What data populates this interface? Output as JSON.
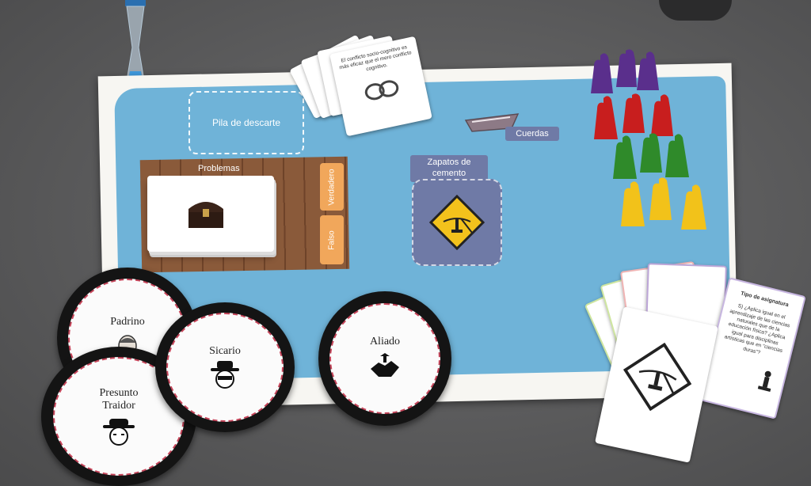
{
  "board": {
    "discard_label": "Pila de descarte",
    "problems_label": "Problemas",
    "true_label": "Verdadero",
    "false_label": "Falso",
    "cement_label": "Zapatos de cemento",
    "ropes_label": "Cuerdas"
  },
  "cards": {
    "top_card_text": "El conflicto socio-cognitivo es más eficaz que el mero conflicto cognitivo.",
    "right_card_title": "Tipo de asignatura",
    "right_card_text": "S) ¿Aplica igual en el aprendizaje de las ciencias naturales que de la educación física? ¿Aplica igual para disciplinas artísticas que en \"ciencias duras\"?"
  },
  "tokens": {
    "padrino": "Padrino",
    "sicario": "Sicario",
    "presunto_traidor": "Presunto Traidor",
    "aliado": "Aliado"
  },
  "pieces": {
    "colors": {
      "purple": "#5a2f8c",
      "red": "#c81e1e",
      "green": "#2f8a2a",
      "yellow": "#f2c21a"
    }
  },
  "colors": {
    "board_blue": "#6fb3d8",
    "label_purple": "#6f7aa6",
    "button_orange": "#f1a75b",
    "wood": "#8a5a3a",
    "token_dash": "#c7465b"
  }
}
